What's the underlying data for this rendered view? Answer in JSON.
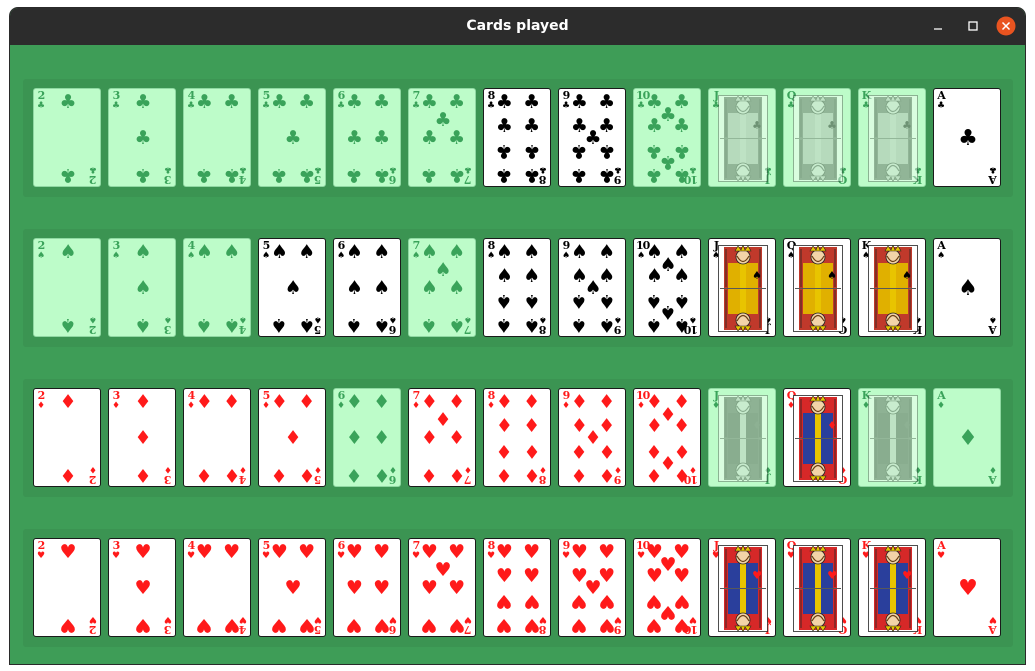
{
  "window": {
    "title": "Cards played",
    "controls": [
      "minimize-icon",
      "maximize-icon",
      "close-icon"
    ],
    "colors": {
      "titlebar": "#2c2c2c",
      "table": "#3e9d57",
      "played": "#bdfcc9",
      "close": "#e95420"
    }
  },
  "ranks": [
    "2",
    "3",
    "4",
    "5",
    "6",
    "7",
    "8",
    "9",
    "10",
    "J",
    "Q",
    "K",
    "A"
  ],
  "rows": [
    {
      "suit": "clubs",
      "symbol": "♣",
      "color": "black",
      "dimmed": [
        true,
        true,
        true,
        true,
        true,
        true,
        false,
        false,
        true,
        true,
        true,
        true,
        false
      ]
    },
    {
      "suit": "spades",
      "symbol": "♠",
      "color": "black",
      "dimmed": [
        true,
        true,
        true,
        false,
        false,
        true,
        false,
        false,
        false,
        false,
        false,
        false,
        false
      ]
    },
    {
      "suit": "diamonds",
      "symbol": "♦",
      "color": "red",
      "dimmed": [
        false,
        false,
        false,
        false,
        true,
        false,
        false,
        false,
        false,
        true,
        false,
        true,
        true
      ]
    },
    {
      "suit": "hearts",
      "symbol": "♥",
      "color": "red",
      "dimmed": [
        false,
        false,
        false,
        false,
        false,
        false,
        false,
        false,
        false,
        false,
        false,
        false,
        false
      ]
    }
  ]
}
